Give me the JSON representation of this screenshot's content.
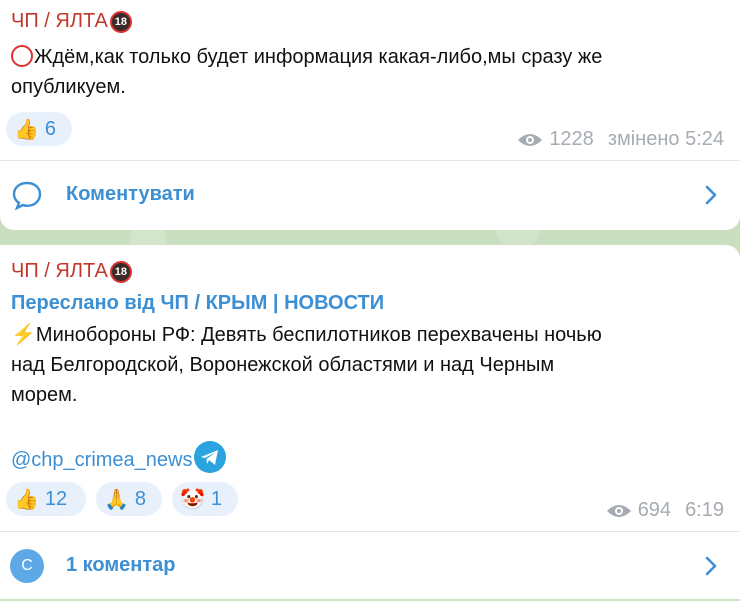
{
  "messages": [
    {
      "sender": "ЧП / ЯЛТА",
      "sender_badge": "18",
      "text_line1": "Ждём,как только будет информация какая-либо,мы сразу же",
      "text_line2": "опубликуем.",
      "reactions": [
        {
          "emoji": "👍",
          "count": "6"
        }
      ],
      "views": "1228",
      "edited_time": "змінено 5:24",
      "comment_action": "Коментувати"
    },
    {
      "sender": "ЧП / ЯЛТА",
      "sender_badge": "18",
      "forwarded_from": "Переслано від ЧП / КРЫМ | НОВОСТИ",
      "text_line1": "Минобороны РФ: Девять беспилотников перехвачены ночью",
      "text_line2": "над Белгородской, Воронежской областями и над Черным",
      "text_line3": "морем.",
      "channel_link": "@chp_crimea_news",
      "reactions": [
        {
          "emoji": "👍",
          "count": "12"
        },
        {
          "emoji": "🙏",
          "count": "8"
        },
        {
          "emoji": "🤡",
          "count": "1"
        }
      ],
      "views": "694",
      "time": "6:19",
      "comments_avatar": "C",
      "comments_label": "1 коментар"
    }
  ],
  "colors": {
    "accent": "#3d8fd3",
    "sender": "#c0392b",
    "meta": "#a5acb3",
    "reaction_bg": "#e8f1fb"
  },
  "icons": [
    "eye-icon",
    "comment-bubble-icon",
    "chevron-right-icon",
    "telegram-icon",
    "lightning-icon",
    "prohibited-icon"
  ]
}
